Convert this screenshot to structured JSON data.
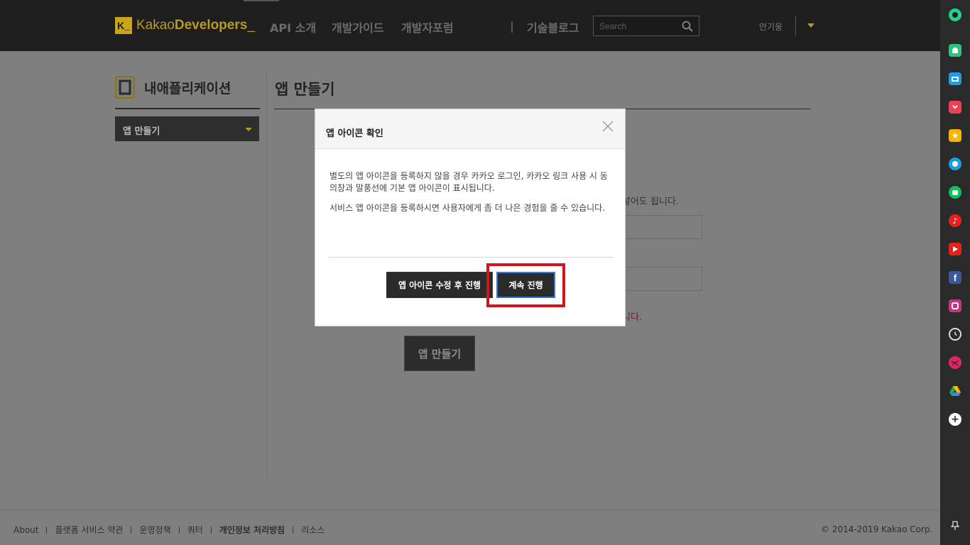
{
  "header": {
    "logo_mark": "K_",
    "logo_light": "Kakao",
    "logo_bold": "Developers",
    "logo_tail": "_",
    "nav": [
      "API 소개",
      "개발가이드",
      "개발자포럼",
      "기술블로그"
    ],
    "search_placeholder": "Search",
    "user_name": "안기웅"
  },
  "sidebar": {
    "title": "내애플리케이션",
    "select_value": "앱 만들기"
  },
  "main": {
    "title": "앱 만들기",
    "partial_text": "넣어도 됩니다.",
    "partial_error": "니다.",
    "create_button": "앱 만들기"
  },
  "modal": {
    "title": "앱 아이콘 확인",
    "body_1": "별도의 앱 아이콘을 등록하지 않을 경우 카카오 로그인, 카카오 링크 사용 시 동의창과 말풍선에 기본 앱 아이콘이 표시됩니다.",
    "body_2": "서비스 앱 아이콘을 등록하시면 사용자에게 좀 더 나은 경험을 줄 수 있습니다.",
    "edit_button": "앱 아이콘 수정 후 진행",
    "continue_button": "계속 진행"
  },
  "footer": {
    "links": [
      "About",
      "플랫폼 서비스 약관",
      "운영정책",
      "쿼터",
      "개인정보 처리방침",
      "리소스"
    ],
    "copyright": "© 2014-2019 Kakao Corp."
  },
  "right_sidebar": {
    "icons": [
      {
        "name": "profile-icon",
        "color": "#25d08d"
      },
      {
        "name": "notification-icon",
        "color": "#2ec27e"
      },
      {
        "name": "archive-icon",
        "color": "#1e9be8"
      },
      {
        "name": "pocket-icon",
        "color": "#ef4056"
      },
      {
        "name": "bookmark-star-icon",
        "color": "#f7b500"
      },
      {
        "name": "edge-icon",
        "color": "#1b9de2"
      },
      {
        "name": "line-icon",
        "color": "#06c755"
      },
      {
        "name": "music-icon",
        "color": "#e82020"
      },
      {
        "name": "youtube-icon",
        "color": "#e62117"
      },
      {
        "name": "facebook-icon",
        "color": "#3b5998"
      },
      {
        "name": "instagram-icon",
        "color": "#c13584"
      },
      {
        "name": "clock-icon",
        "color": "#dddddd"
      },
      {
        "name": "dribbble-icon",
        "color": "#e5245e"
      },
      {
        "name": "google-drive-icon",
        "color": "#1fa463"
      },
      {
        "name": "add-icon",
        "color": "#ffffff"
      },
      {
        "name": "pin-icon",
        "color": "#dddddd"
      }
    ]
  },
  "colors": {
    "brand_yellow": "#c9a617",
    "highlight_red": "#d2151d",
    "focus_blue": "#3b78d4"
  }
}
